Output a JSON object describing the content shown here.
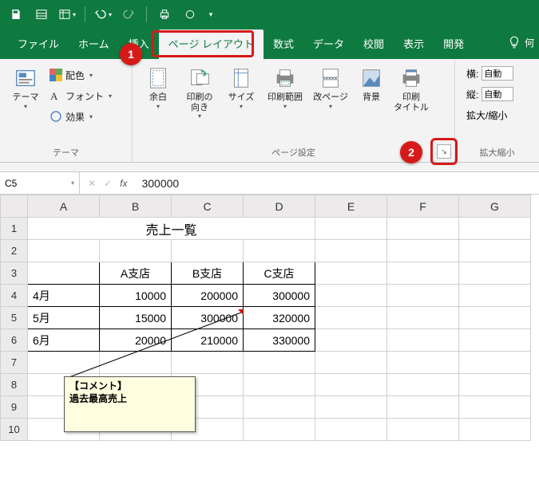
{
  "qat": {
    "save": "save-icon",
    "customize": "customize-icon"
  },
  "tabs": {
    "file": "ファイル",
    "home": "ホーム",
    "insert": "挿入",
    "page_layout": "ページ レイアウト",
    "formulas": "数式",
    "data": "データ",
    "review": "校閲",
    "view": "表示",
    "developer": "開発"
  },
  "tell_me": "何",
  "callouts": {
    "one": "1",
    "two": "2"
  },
  "ribbon": {
    "themes_group": {
      "label": "テーマ",
      "themes_btn": "テーマ",
      "colors": "配色",
      "fonts": "フォント",
      "effects": "効果"
    },
    "page_setup_group": {
      "label": "ページ設定",
      "margins": "余白",
      "orientation": "印刷の\n向き",
      "size": "サイズ",
      "print_area": "印刷範囲",
      "breaks": "改ページ",
      "background": "背景",
      "print_titles": "印刷\nタイトル"
    },
    "scale_group": {
      "label": "拡大縮小",
      "width_lbl": "横:",
      "height_lbl": "縦:",
      "scale_lbl": "拡大/縮小",
      "auto": "自動"
    }
  },
  "formula_bar": {
    "namebox": "C5",
    "value": "300000"
  },
  "columns": [
    "A",
    "B",
    "C",
    "D",
    "E",
    "F",
    "G"
  ],
  "rows": [
    "1",
    "2",
    "3",
    "4",
    "5",
    "6",
    "7",
    "8",
    "9",
    "10"
  ],
  "sheet": {
    "title": "売上一覧",
    "headers": {
      "b": "A支店",
      "c": "B支店",
      "d": "C支店"
    },
    "r4": {
      "a": "4月",
      "b": "10000",
      "c": "200000",
      "d": "300000"
    },
    "r5": {
      "a": "5月",
      "b": "15000",
      "c": "300000",
      "d": "320000"
    },
    "r6": {
      "a": "6月",
      "b": "20000",
      "c": "210000",
      "d": "330000"
    }
  },
  "comment": {
    "line1": "【コメント】",
    "line2": "過去最高売上"
  }
}
